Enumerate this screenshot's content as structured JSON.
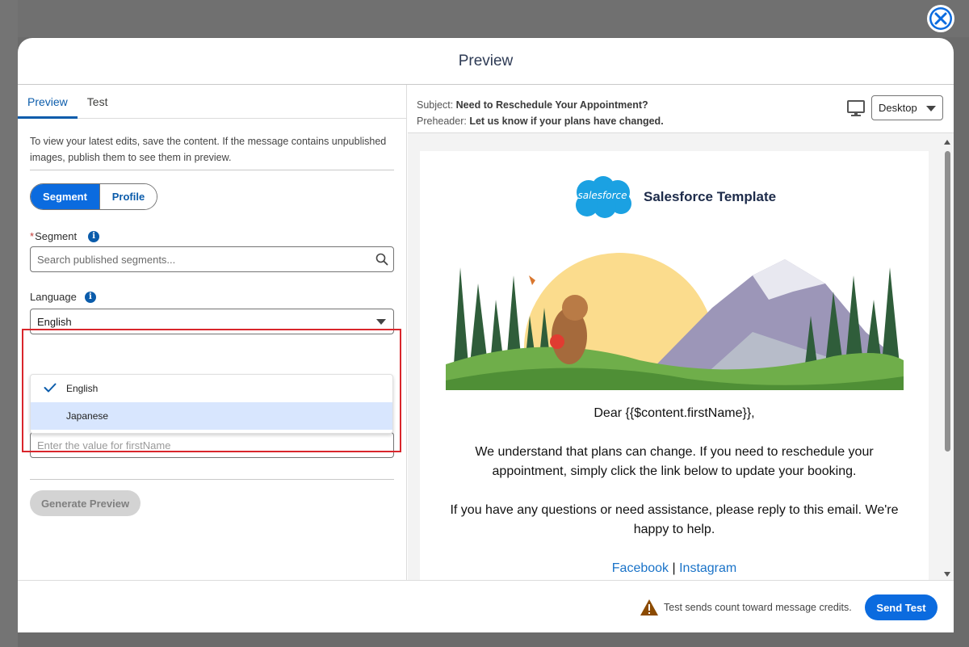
{
  "modal": {
    "title": "Preview"
  },
  "tabs": [
    {
      "label": "Preview",
      "active": true
    },
    {
      "label": "Test",
      "active": false
    }
  ],
  "info_text": "To view your latest edits, save the content. If the message contains unpublished images, publish them to see them in preview.",
  "toggle": {
    "segment_label": "Segment",
    "profile_label": "Profile",
    "selected": "Segment"
  },
  "segment_field": {
    "required_mark": "*",
    "label": "Segment",
    "placeholder": "Search published segments..."
  },
  "language_field": {
    "label": "Language",
    "value": "English"
  },
  "language_options": [
    {
      "label": "English",
      "selected": true
    },
    {
      "label": "Japanese",
      "selected": false,
      "hovered": true
    }
  ],
  "firstname_field": {
    "placeholder": "Enter the value for firstName"
  },
  "generate_button": {
    "label": "Generate Preview",
    "disabled": true
  },
  "preview_header": {
    "subject_label": "Subject:",
    "subject": "Need to Reschedule Your Appointment?",
    "preheader_label": "Preheader:",
    "preheader": "Let us know if your plans have changed.",
    "device": "Desktop"
  },
  "email": {
    "logo_text": "salesforce",
    "brand_title": "Salesforce Template",
    "greeting": "Dear {{$content.firstName}},",
    "paragraph1": "We understand that plans can change. If you need to reschedule your appointment, simply click the link below to update your booking.",
    "paragraph2": "If you have any questions or need assistance, please reply to this email. We're happy to help.",
    "link1": "Facebook",
    "link_sep": "|",
    "link2": "Instagram"
  },
  "footer": {
    "warning": "Test sends count toward message credits.",
    "send_label": "Send Test"
  },
  "colors": {
    "brand_blue": "#0b6bdf",
    "highlight_red": "#d9262c",
    "link_blue": "#1a73c8"
  },
  "icons": {
    "close": "close-icon",
    "info": "info-icon",
    "search": "search-icon",
    "check": "check-icon",
    "monitor": "monitor-icon",
    "warning": "warning-icon"
  }
}
